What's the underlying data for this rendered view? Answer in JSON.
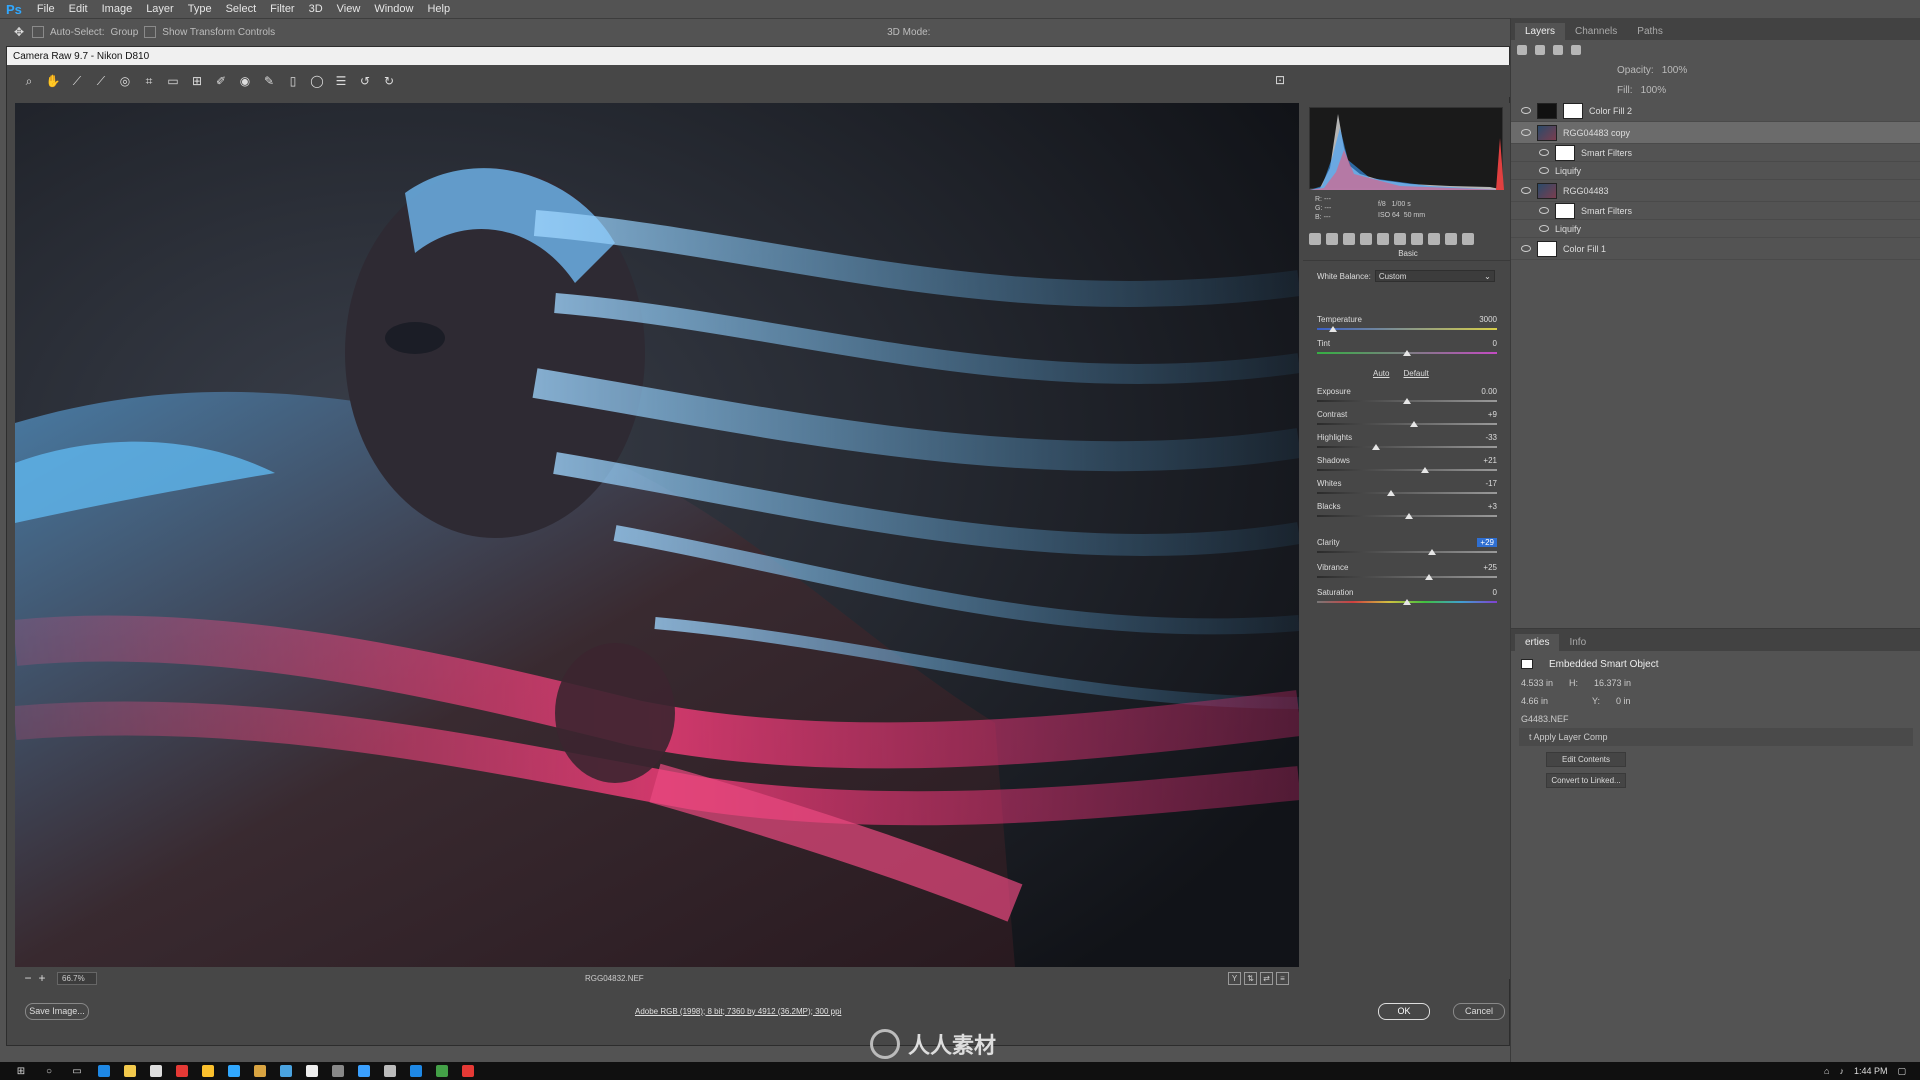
{
  "ps": {
    "logo": "Ps",
    "menus": [
      "File",
      "Edit",
      "Image",
      "Layer",
      "Type",
      "Select",
      "Filter",
      "3D",
      "View",
      "Window",
      "Help"
    ],
    "options": {
      "auto_select": "Auto-Select:",
      "group": "Group",
      "transform": "Show Transform Controls",
      "mode3d": "3D Mode:"
    }
  },
  "acr": {
    "title": "Camera Raw 9.7  -  Nikon D810",
    "status": {
      "zoom": "66.7%",
      "filename": "RGG04832.NEF"
    },
    "buttons": {
      "save": "Save Image...",
      "workflow": "Adobe RGB (1998); 8 bit; 7360 by 4912 (36.2MP); 300 ppi",
      "ok": "OK",
      "cancel": "Cancel"
    },
    "exif": {
      "r": "R:",
      "g": "G:",
      "b": "B:",
      "dash": "---",
      "aperture": "f/8",
      "shutter": "1/00 s",
      "iso": "ISO 64",
      "focal": "50 mm"
    },
    "panel_name": "Basic",
    "white_balance": {
      "label": "White Balance:",
      "value": "Custom"
    },
    "auto": "Auto",
    "default": "Default",
    "sliders": [
      {
        "label": "Temperature",
        "value": "3000",
        "pos": 0.09,
        "track": "temp"
      },
      {
        "label": "Tint",
        "value": "0",
        "pos": 0.5,
        "track": "tint"
      },
      {
        "label": "Exposure",
        "value": "0.00",
        "pos": 0.5,
        "track": ""
      },
      {
        "label": "Contrast",
        "value": "+9",
        "pos": 0.54,
        "track": ""
      },
      {
        "label": "Highlights",
        "value": "-33",
        "pos": 0.33,
        "track": ""
      },
      {
        "label": "Shadows",
        "value": "+21",
        "pos": 0.6,
        "track": ""
      },
      {
        "label": "Whites",
        "value": "-17",
        "pos": 0.41,
        "track": ""
      },
      {
        "label": "Blacks",
        "value": "+3",
        "pos": 0.51,
        "track": ""
      },
      {
        "label": "Clarity",
        "value": "+29",
        "pos": 0.64,
        "track": "",
        "highlight": true
      },
      {
        "label": "Vibrance",
        "value": "+25",
        "pos": 0.62,
        "track": ""
      },
      {
        "label": "Saturation",
        "value": "0",
        "pos": 0.5,
        "track": "sat"
      }
    ]
  },
  "layers_panel": {
    "tabs": [
      "Layers",
      "Channels",
      "Paths"
    ],
    "opacity_label": "Opacity:",
    "opacity_value": "100%",
    "fill_label": "Fill:",
    "fill_value": "100%",
    "layers": [
      {
        "name": "Color Fill 2",
        "type": "fill-dark",
        "sub": false,
        "selected": false
      },
      {
        "name": "RGG04483 copy",
        "type": "photo",
        "sub": false,
        "selected": true
      },
      {
        "name": "Smart Filters",
        "type": "white",
        "sub": true,
        "selected": false
      },
      {
        "name": "Liquify",
        "type": "none",
        "sub": true,
        "selected": false
      },
      {
        "name": "RGG04483",
        "type": "photo",
        "sub": false,
        "selected": false
      },
      {
        "name": "Smart Filters",
        "type": "white",
        "sub": true,
        "selected": false
      },
      {
        "name": "Liquify",
        "type": "none",
        "sub": true,
        "selected": false
      },
      {
        "name": "Color Fill 1",
        "type": "white",
        "sub": false,
        "selected": false
      }
    ]
  },
  "properties_panel": {
    "tabs": [
      "erties",
      "Info"
    ],
    "title": "Embedded Smart Object",
    "w": "4.533 in",
    "h_label": "H:",
    "h": "16.373 in",
    "x": "4.66 in",
    "y_label": "Y:",
    "y": "0 in",
    "file": "G4483.NEF",
    "comp": "t Apply Layer Comp",
    "edit": "Edit Contents",
    "convert": "Convert to Linked..."
  },
  "watermark": "人人素材",
  "taskbar": {
    "time": "1:44 PM"
  }
}
